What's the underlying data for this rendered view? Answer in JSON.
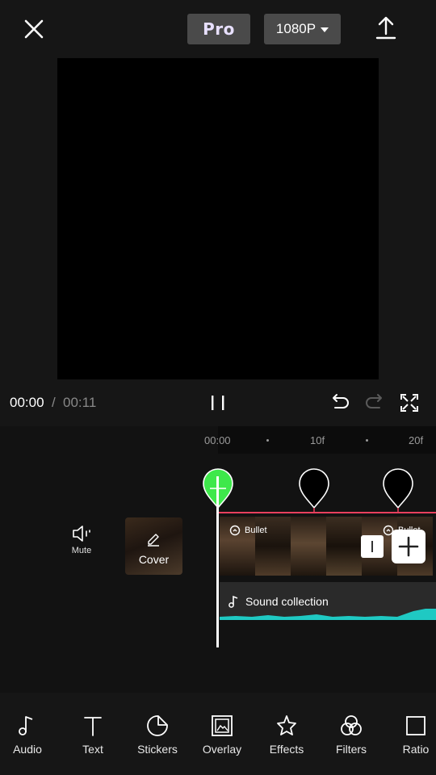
{
  "top_bar": {
    "close_icon": "close-icon",
    "pro_label": "Pro",
    "resolution_label": "1080P",
    "export_icon": "upload-icon"
  },
  "playback": {
    "current_time": "00:00",
    "separator": "/",
    "total_time": "00:11"
  },
  "ruler": {
    "labels": [
      "00:00",
      "10f",
      "20f"
    ]
  },
  "controls": {
    "mute_label": "Mute",
    "cover_label": "Cover"
  },
  "video_track": {
    "effects": [
      "Bullet",
      "Bullet"
    ]
  },
  "audio_track": {
    "label": "Sound collection"
  },
  "toolbar": {
    "items": [
      {
        "label": "Audio",
        "icon": "music-note-icon"
      },
      {
        "label": "Text",
        "icon": "text-icon"
      },
      {
        "label": "Stickers",
        "icon": "sticker-icon"
      },
      {
        "label": "Overlay",
        "icon": "overlay-icon"
      },
      {
        "label": "Effects",
        "icon": "effects-star-icon"
      },
      {
        "label": "Filters",
        "icon": "filters-icon"
      },
      {
        "label": "Ratio",
        "icon": "ratio-icon"
      }
    ]
  },
  "colors": {
    "accent_green": "#3ee84b",
    "track_border": "#e8405d",
    "waveform": "#1fc9c3"
  }
}
